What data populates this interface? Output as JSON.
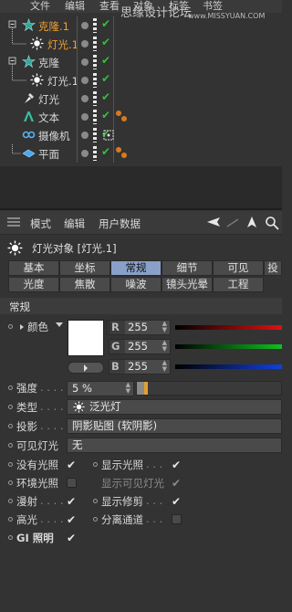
{
  "object_manager": {
    "menu": [
      "文件",
      "编辑",
      "查看",
      "对象",
      "标签",
      "书签"
    ],
    "watermark": "思缘设计论坛",
    "watermark_url": "www.MISSYUAN.COM",
    "rows": [
      {
        "name": "克隆.1",
        "icon": "cloner-icon",
        "color": "#f0a030"
      },
      {
        "name": "灯光.1",
        "icon": "light-icon",
        "color": "#f0a030"
      },
      {
        "name": "克隆",
        "icon": "cloner-icon",
        "color": "#d8d8d8"
      },
      {
        "name": "灯光.1",
        "icon": "light-icon",
        "color": "#d8d8d8"
      },
      {
        "name": "灯光",
        "icon": "spotlight-icon",
        "color": "#d8d8d8"
      },
      {
        "name": "文本",
        "icon": "text-icon",
        "color": "#d8d8d8"
      },
      {
        "name": "摄像机",
        "icon": "camera-icon",
        "color": "#d8d8d8"
      },
      {
        "name": "平面",
        "icon": "plane-icon",
        "color": "#d8d8d8"
      }
    ]
  },
  "attribute_manager": {
    "menu": {
      "mode": "模式",
      "edit": "编辑",
      "user_data": "用户数据"
    },
    "title": "灯光对象 [灯光.1]",
    "tabs_row1": [
      "基本",
      "坐标",
      "常规",
      "细节",
      "可见",
      "投"
    ],
    "tabs_row2": [
      "光度",
      "焦散",
      "噪波",
      "镜头光晕",
      "工程"
    ],
    "active_tab": "常规",
    "section": "常规",
    "color": {
      "label": "颜色",
      "r_label": "R",
      "r": "255",
      "g_label": "G",
      "g": "255",
      "b_label": "B",
      "b": "255",
      "swatch": "#ffffff"
    },
    "intensity": {
      "label": "强度",
      "value": "5 %",
      "percent": 5
    },
    "type": {
      "label": "类型",
      "value": "泛光灯"
    },
    "shadow": {
      "label": "投影",
      "value": "阴影贴图 (软阴影)"
    },
    "visible_light": {
      "label": "可见灯光",
      "value": "无"
    },
    "checkboxes_left": [
      {
        "label": "没有光照",
        "checked": true
      },
      {
        "label": "环境光照",
        "checked": false
      },
      {
        "label": "漫射",
        "checked": true
      },
      {
        "label": "高光",
        "checked": true
      },
      {
        "label": "GI 照明",
        "checked": true
      }
    ],
    "checkboxes_right": [
      {
        "label": "显示光照",
        "checked": true,
        "dim": false
      },
      {
        "label": "显示可见灯光",
        "checked": true,
        "dim": true
      },
      {
        "label": "显示修剪",
        "checked": true,
        "dim": false
      },
      {
        "label": "分离通道",
        "checked": false,
        "dim": false
      }
    ]
  }
}
